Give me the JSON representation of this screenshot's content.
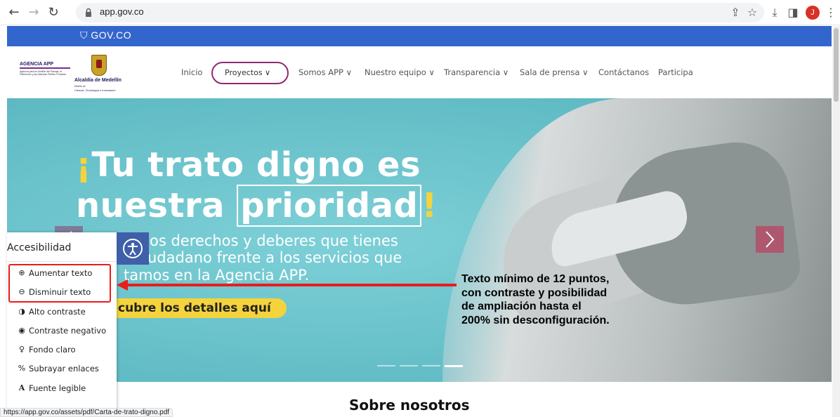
{
  "browser": {
    "url": "app.gov.co",
    "profile_initial": "J",
    "status_url": "https://app.gov.co/assets/pdf/Carta-de-trato-digno.pdf"
  },
  "govbar": {
    "logo_text": "GOV.CO"
  },
  "header": {
    "logo_agencia_title": "AGENCIA APP",
    "logo_agencia_sub": "Agencia para la Gestión del Paisaje, el Patrimonio y las Alianzas Público Privadas",
    "logo_medellin_title": "Alcaldía de Medellín",
    "logo_medellin_sub": "Distrito de",
    "logo_medellin_sub2": "Ciencia, Tecnología e Innovación",
    "menu": {
      "inicio": "Inicio",
      "proyectos": "Proyectos ∨",
      "somos": "Somos APP ∨",
      "equipo": "Nuestro equipo ∨",
      "transparencia": "Transparencia ∨",
      "prensa": "Sala de prensa ∨",
      "contactanos": "Contáctanos",
      "participa": "Participa"
    }
  },
  "hero": {
    "line1_excl": "¡",
    "line1_text": "Tu trato digno es",
    "line2_text": "nuestra ",
    "line2_boxed": "prioridad",
    "line2_excl": "!",
    "sub1": "os derechos y deberes que tienes",
    "sub2": "udadano frente a los servicios que",
    "sub3": "tamos en la Agencia APP.",
    "cta": "cubre los detalles aquí",
    "slides_total": 4,
    "slide_active": 4
  },
  "annotation": {
    "line1": "Texto mínimo de 12 puntos,",
    "line2": "con contraste y posibilidad",
    "line3": "de ampliación hasta el",
    "line4": "200% sin desconfiguración."
  },
  "accessibility": {
    "title": "Accesibilidad",
    "items": [
      {
        "label": "Aumentar texto",
        "icon": "zoom-in-icon",
        "glyph": "⊕"
      },
      {
        "label": "Disminuir texto",
        "icon": "zoom-out-icon",
        "glyph": "⊖"
      },
      {
        "label": "Alto contraste",
        "icon": "contrast-icon",
        "glyph": "◑"
      },
      {
        "label": "Contraste negativo",
        "icon": "eye-icon",
        "glyph": "◉"
      },
      {
        "label": "Fondo claro",
        "icon": "bulb-icon",
        "glyph": "♀"
      },
      {
        "label": "Subrayar enlaces",
        "icon": "link-icon",
        "glyph": "%"
      },
      {
        "label": "Fuente legible",
        "icon": "font-icon",
        "glyph": "A"
      }
    ]
  },
  "section": {
    "about_title": "Sobre nosotros"
  },
  "colors": {
    "gov_blue": "#3366cc",
    "hero_teal": "#6fc7cf",
    "accent_yellow": "#f5d33c",
    "annotation_red": "#e81d1d",
    "purple": "#8e2b6e"
  }
}
